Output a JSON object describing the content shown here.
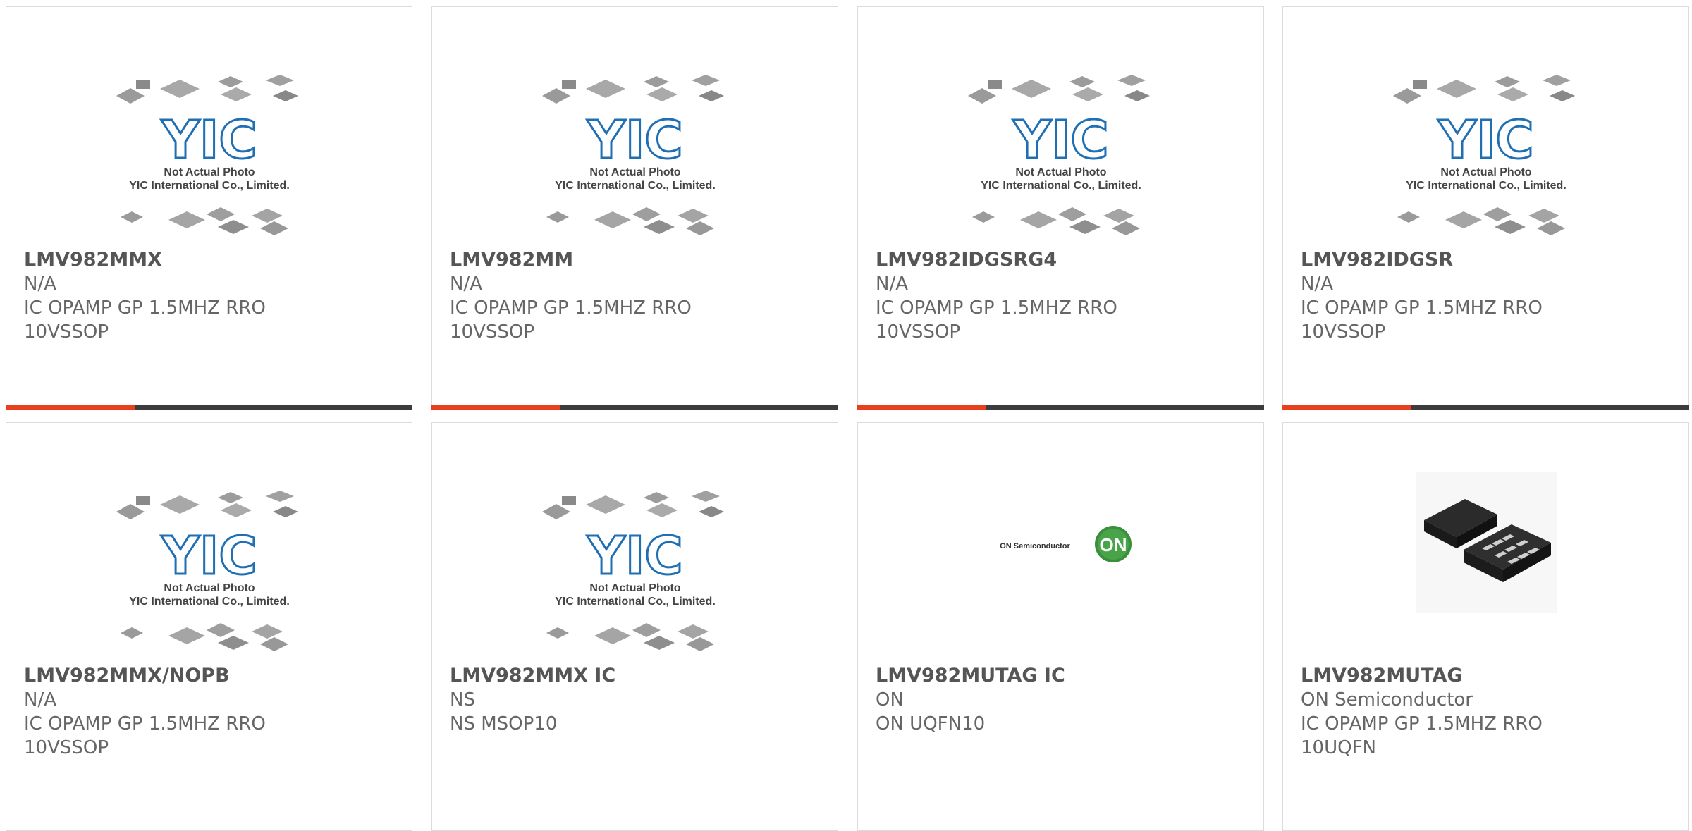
{
  "products": [
    {
      "part": "LMV982MMX",
      "maker": "N/A",
      "desc1": "IC OPAMP GP 1.5MHZ RRO",
      "desc2": "10VSSOP",
      "image": "yic-placeholder",
      "caption1": "Not Actual Photo",
      "caption2": "YIC International Co., Limited.",
      "accent": "#e8401c"
    },
    {
      "part": "LMV982MM",
      "maker": "N/A",
      "desc1": "IC OPAMP GP 1.5MHZ RRO",
      "desc2": "10VSSOP",
      "image": "yic-placeholder",
      "caption1": "Not Actual Photo",
      "caption2": "YIC International Co., Limited.",
      "accent": "#e8401c"
    },
    {
      "part": "LMV982IDGSRG4",
      "maker": "N/A",
      "desc1": "IC OPAMP GP 1.5MHZ RRO",
      "desc2": "10VSSOP",
      "image": "yic-placeholder",
      "caption1": "Not Actual Photo",
      "caption2": "YIC International Co., Limited.",
      "accent": "#e8401c"
    },
    {
      "part": "LMV982IDGSR",
      "maker": "N/A",
      "desc1": "IC OPAMP GP 1.5MHZ RRO",
      "desc2": "10VSSOP",
      "image": "yic-placeholder",
      "caption1": "Not Actual Photo",
      "caption2": "YIC International Co., Limited.",
      "accent": "#e8401c"
    },
    {
      "part": "LMV982MMX/NOPB",
      "maker": "N/A",
      "desc1": "IC OPAMP GP 1.5MHZ RRO",
      "desc2": "10VSSOP",
      "image": "yic-placeholder",
      "caption1": "Not Actual Photo",
      "caption2": "YIC International Co., Limited."
    },
    {
      "part": "LMV982MMX IC",
      "maker": "NS",
      "desc1": "NS MSOP10",
      "desc2": "",
      "image": "yic-placeholder",
      "caption1": "Not Actual Photo",
      "caption2": "YIC International Co., Limited."
    },
    {
      "part": "LMV982MUTAG IC",
      "maker": "ON",
      "desc1": "ON UQFN10",
      "desc2": "",
      "image": "on-semiconductor-logo",
      "logo_text": "ON Semiconductor",
      "logo_mark": "ON"
    },
    {
      "part": "LMV982MUTAG",
      "maker": "ON Semiconductor",
      "desc1": "IC OPAMP GP 1.5MHZ RRO",
      "desc2": "10UQFN",
      "image": "uqfn-package-photo"
    }
  ],
  "colors": {
    "accent": "#e8401c",
    "bar": "#3c3c3c",
    "yic_blue": "#1f6fb5"
  }
}
